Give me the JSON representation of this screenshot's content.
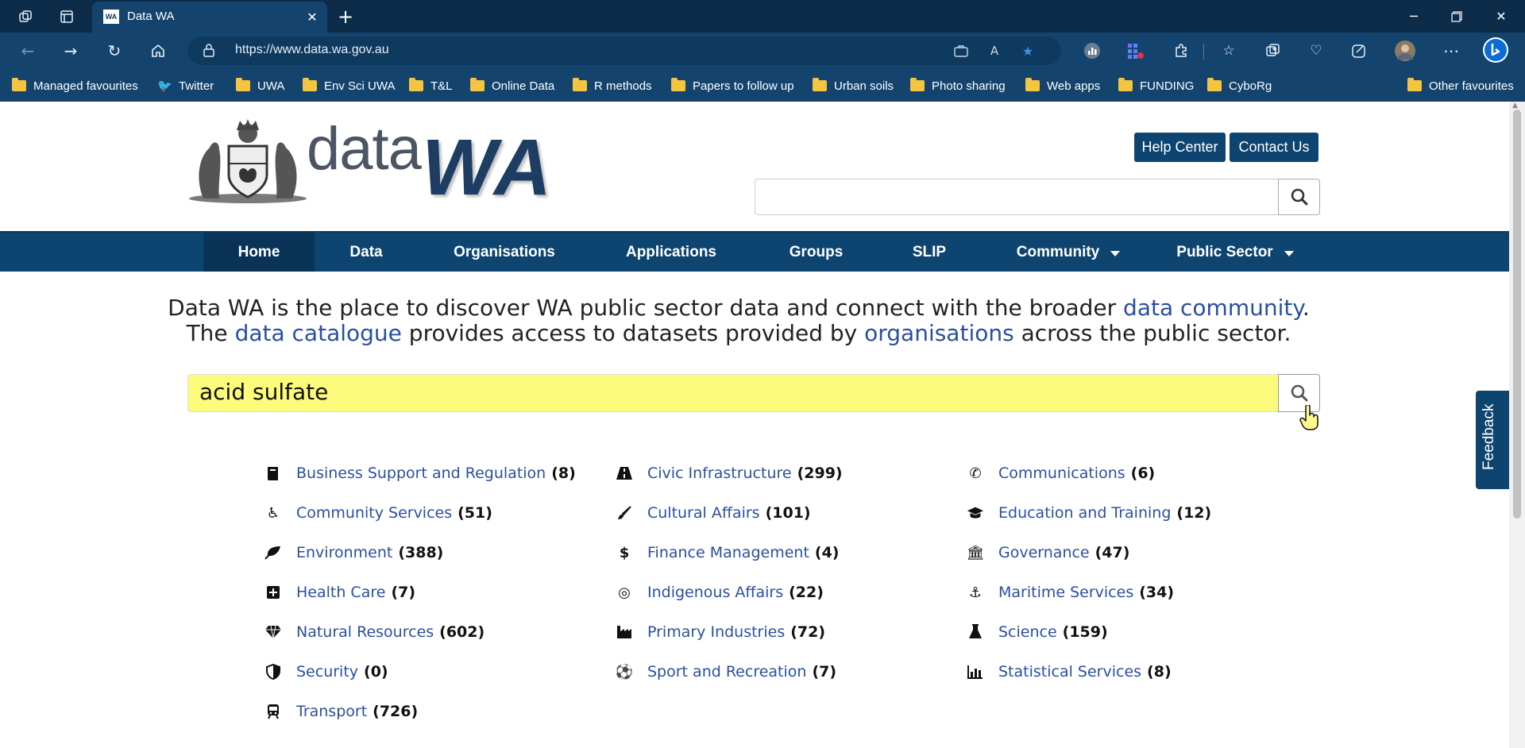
{
  "browser": {
    "tab_title": "Data WA",
    "tab_favicon": "WA",
    "url_host": "https://www.data.wa.gov.au",
    "favourites": [
      {
        "label": "Managed favourites",
        "icon": "folder-icon"
      },
      {
        "label": "Twitter",
        "icon": "twitter-icon"
      },
      {
        "label": "UWA",
        "icon": "folder-icon"
      },
      {
        "label": "Env Sci UWA",
        "icon": "folder-icon"
      },
      {
        "label": "T&L",
        "icon": "folder-icon"
      },
      {
        "label": "Online Data",
        "icon": "folder-icon"
      },
      {
        "label": "R methods",
        "icon": "folder-icon"
      },
      {
        "label": "Papers to follow up",
        "icon": "folder-icon"
      },
      {
        "label": "Urban soils",
        "icon": "folder-icon"
      },
      {
        "label": "Photo sharing",
        "icon": "folder-icon"
      },
      {
        "label": "Web apps",
        "icon": "folder-icon"
      },
      {
        "label": "FUNDING",
        "icon": "folder-icon"
      },
      {
        "label": "CyboRg",
        "icon": "folder-icon"
      }
    ],
    "other_favourites": "Other favourites"
  },
  "site": {
    "logo_data": "data",
    "logo_wa": "WA",
    "help_center": "Help Center",
    "contact_us": "Contact Us",
    "top_search_value": ""
  },
  "nav": {
    "home": "Home",
    "data": "Data",
    "organisations": "Organisations",
    "applications": "Applications",
    "groups": "Groups",
    "slip": "SLIP",
    "community": "Community",
    "public_sector": "Public Sector"
  },
  "intro": {
    "l1_a": "Data WA is the place to discover WA public sector data and connect with the broader ",
    "l1_link": "data community",
    "l1_b": ".",
    "l2_a": "The ",
    "l2_link1": "data catalogue",
    "l2_b": " provides access to datasets provided by ",
    "l2_link2": "organisations",
    "l2_c": " across the public sector."
  },
  "search": {
    "query": "acid sulfate"
  },
  "categories": [
    {
      "label": "Business Support and Regulation",
      "count": "(8)",
      "icon": "book-icon"
    },
    {
      "label": "Civic Infrastructure",
      "count": "(299)",
      "icon": "road-icon"
    },
    {
      "label": "Communications",
      "count": "(6)",
      "icon": "phone-icon"
    },
    {
      "label": "Community Services",
      "count": "(51)",
      "icon": "wheelchair-icon"
    },
    {
      "label": "Cultural Affairs",
      "count": "(101)",
      "icon": "paintbrush-icon"
    },
    {
      "label": "Education and Training",
      "count": "(12)",
      "icon": "graduation-cap-icon"
    },
    {
      "label": "Environment",
      "count": "(388)",
      "icon": "leaf-icon"
    },
    {
      "label": "Finance Management",
      "count": "(4)",
      "icon": "dollar-icon"
    },
    {
      "label": "Governance",
      "count": "(47)",
      "icon": "institution-icon"
    },
    {
      "label": "Health Care",
      "count": "(7)",
      "icon": "medical-plus-icon"
    },
    {
      "label": "Indigenous Affairs",
      "count": "(22)",
      "icon": "bullseye-icon"
    },
    {
      "label": "Maritime Services",
      "count": "(34)",
      "icon": "anchor-icon"
    },
    {
      "label": "Natural Resources",
      "count": "(602)",
      "icon": "diamond-icon"
    },
    {
      "label": "Primary Industries",
      "count": "(72)",
      "icon": "industry-icon"
    },
    {
      "label": "Science",
      "count": "(159)",
      "icon": "flask-icon"
    },
    {
      "label": "Security",
      "count": "(0)",
      "icon": "shield-icon"
    },
    {
      "label": "Sport and Recreation",
      "count": "(7)",
      "icon": "soccer-ball-icon"
    },
    {
      "label": "Statistical Services",
      "count": "(8)",
      "icon": "bar-chart-icon"
    },
    {
      "label": "Transport",
      "count": "(726)",
      "icon": "train-icon"
    }
  ],
  "feedback": "Feedback"
}
